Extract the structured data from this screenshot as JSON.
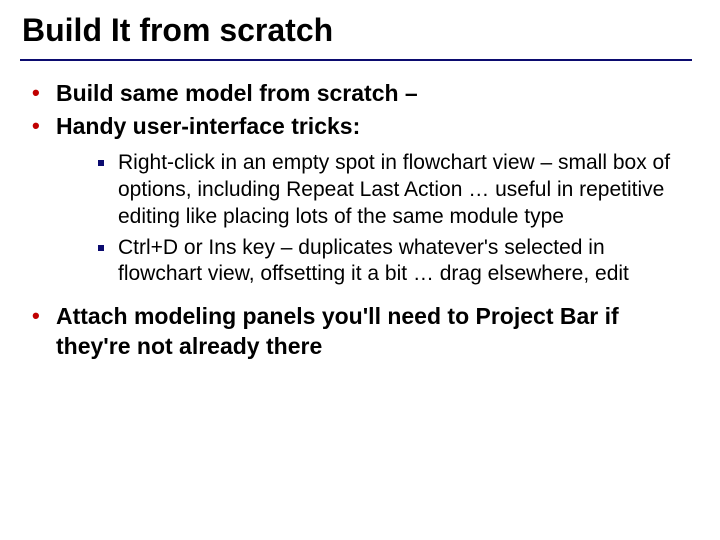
{
  "title": "Build It from scratch",
  "bullets": {
    "b1": "Build same model from scratch –",
    "b2": "Handy user-interface tricks:",
    "b2sub": {
      "s1": "Right-click in an empty spot in flowchart view – small box of options, including Repeat Last Action … useful in repetitive editing like placing lots of the same module type",
      "s2": "Ctrl+D or Ins key – duplicates whatever's selected in flowchart view, offsetting it a bit … drag elsewhere, edit"
    },
    "b3": "Attach modeling panels you'll need to Project Bar if they're not already there"
  }
}
